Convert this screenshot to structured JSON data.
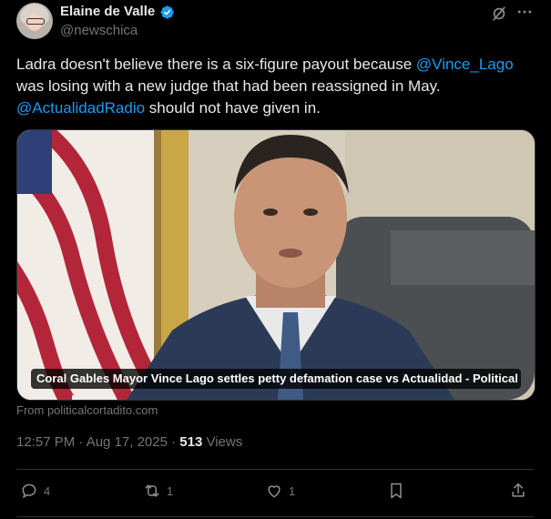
{
  "author": {
    "name": "Elaine de Valle",
    "handle": "@newschica",
    "verified": true
  },
  "tweet": {
    "segments": [
      {
        "text": "Ladra doesn't believe there is a six-figure payout because ",
        "type": "text"
      },
      {
        "text": "@Vince_Lago",
        "type": "mention"
      },
      {
        "text": " was losing with a new judge that had been reassigned in May. ",
        "type": "text"
      },
      {
        "text": "@ActualidadRadio",
        "type": "mention"
      },
      {
        "text": " should not have given in.",
        "type": "text"
      }
    ]
  },
  "media": {
    "caption": "Coral Gables Mayor Vince Lago settles petty defamation case vs Actualidad - Political ...",
    "source": "From politicalcortadito.com"
  },
  "meta": {
    "timestamp": "12:57 PM · Aug 17, 2025 · ",
    "views_count": "513",
    "views_label": " Views"
  },
  "actions": {
    "replies": "4",
    "reposts": "1",
    "likes": "1"
  },
  "icons": {
    "verified": "verified-badge-icon",
    "grok": "grok-icon",
    "more": "more-icon",
    "reply": "reply-icon",
    "repost": "repost-icon",
    "like": "like-icon",
    "bookmark": "bookmark-icon",
    "share": "share-icon"
  },
  "colors": {
    "background": "#000000",
    "text": "#e7e9ea",
    "muted": "#71767b",
    "accent": "#1d9bf0",
    "border": "#2f3336"
  }
}
